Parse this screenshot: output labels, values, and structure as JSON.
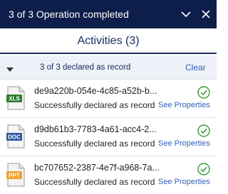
{
  "titlebar": {
    "title": "3 of 3 Operation completed",
    "collapse_icon": "chevron-down-icon",
    "close_icon": "close-icon",
    "background": "#0e1e4a"
  },
  "activities": {
    "heading": "Activities (3)"
  },
  "summary": {
    "text": "3 of 3 declared as record",
    "clear_label": "Clear"
  },
  "items": [
    {
      "file_type": "XLS",
      "icon": "excel-file-icon",
      "badge_color": "#2e7d32",
      "name": "de9a220b-054e-4c85-a52b-b...",
      "status": "Successfully declared as record",
      "link": "See Properties"
    },
    {
      "file_type": "DOC",
      "icon": "word-file-icon",
      "badge_color": "#2b579a",
      "name": "d9db61b3-7783-4a61-acc4-2...",
      "status": "Successfully declared as record",
      "link": "See Properties"
    },
    {
      "file_type": "PPT",
      "icon": "powerpoint-file-icon",
      "badge_color": "#f0a030",
      "name": "bc707652-2387-4e7f-a968-7a...",
      "status": "Successfully declared as record",
      "link": "See Properties"
    }
  ],
  "colors": {
    "accent": "#1c2e63",
    "link": "#2f5fb8",
    "success": "#3a9a3a"
  }
}
